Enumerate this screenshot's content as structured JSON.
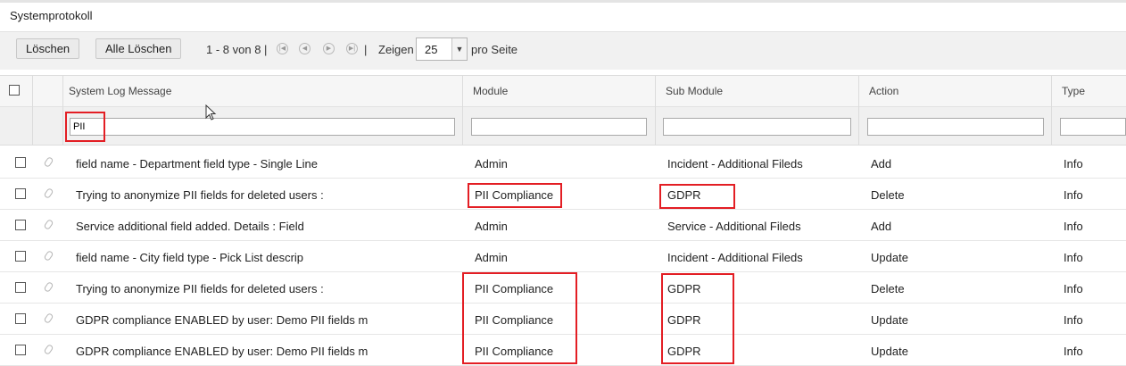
{
  "page": {
    "title": "Systemprotokoll"
  },
  "toolbar": {
    "delete_label": "Löschen",
    "delete_all_label": "Alle Löschen",
    "range_text": "1 - 8 von 8 |",
    "separator": "|",
    "show_label": "Zeigen",
    "per_page_value": "25",
    "per_page_suffix": "pro Seite"
  },
  "grid": {
    "columns": [
      "System Log Message",
      "Module",
      "Sub Module",
      "Action",
      "Type"
    ],
    "filter_message_value": "PII",
    "rows": [
      {
        "message": "field name - Department field type - Single Line",
        "module": "Admin",
        "submodule": "Incident - Additional Fileds",
        "action": "Add",
        "type": "Info"
      },
      {
        "message": "Trying to anonymize PII fields for deleted users :",
        "module": "PII Compliance",
        "submodule": "GDPR",
        "action": "Delete",
        "type": "Info"
      },
      {
        "message": "Service additional field added. Details : Field",
        "module": "Admin",
        "submodule": "Service - Additional Fileds",
        "action": "Add",
        "type": "Info"
      },
      {
        "message": "field name - City field type - Pick List descrip",
        "module": "Admin",
        "submodule": "Incident - Additional Fileds",
        "action": "Update",
        "type": "Info"
      },
      {
        "message": "Trying to anonymize PII fields for deleted users :",
        "module": "PII Compliance",
        "submodule": "GDPR",
        "action": "Delete",
        "type": "Info"
      },
      {
        "message": "GDPR compliance ENABLED by user: Demo PII fields m",
        "module": "PII Compliance",
        "submodule": "GDPR",
        "action": "Update",
        "type": "Info"
      },
      {
        "message": "GDPR compliance ENABLED by user: Demo PII fields m",
        "module": "PII Compliance",
        "submodule": "GDPR",
        "action": "Update",
        "type": "Info"
      }
    ]
  },
  "colors": {
    "highlight": "#e31e24",
    "header_bg": "#f6f6f6",
    "toolbar_bg": "#f1f1f1"
  },
  "icons": [
    "first-page-icon",
    "prev-page-icon",
    "next-page-icon",
    "last-page-icon",
    "chevron-down-icon",
    "paperclip-icon",
    "mouse-cursor-icon"
  ]
}
